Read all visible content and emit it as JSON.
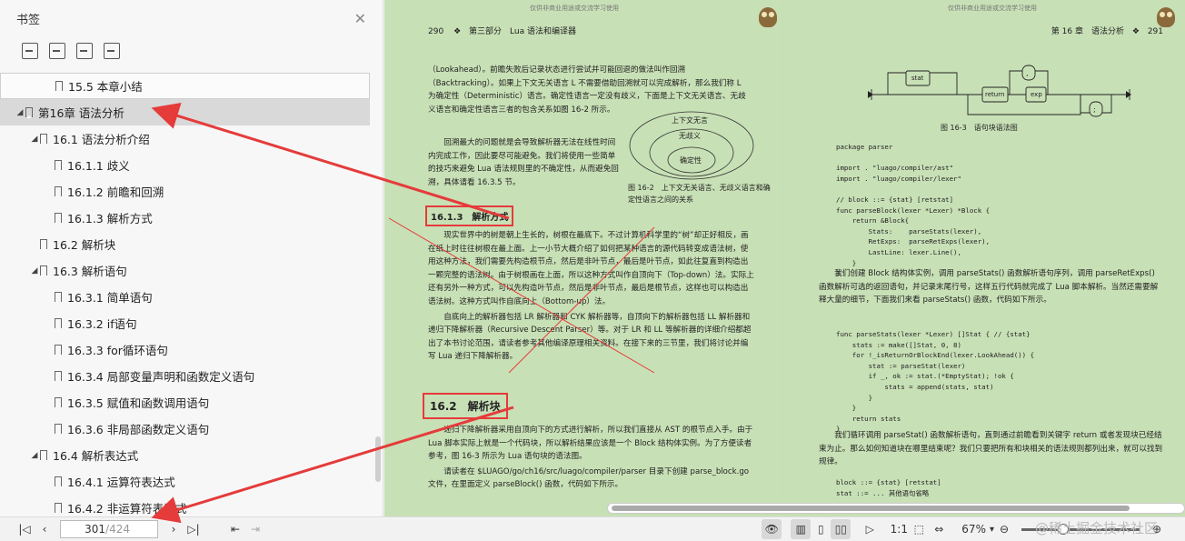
{
  "sidebar": {
    "title": "书签",
    "toc": [
      {
        "label": "15.5 本章小结",
        "level": 2,
        "caret": ""
      },
      {
        "label": "第16章 语法分析",
        "level": 0,
        "caret": "◢"
      },
      {
        "label": "16.1 语法分析介绍",
        "level": 1,
        "caret": "◢"
      },
      {
        "label": "16.1.1 歧义",
        "level": 2,
        "caret": ""
      },
      {
        "label": "16.1.2 前瞻和回溯",
        "level": 2,
        "caret": ""
      },
      {
        "label": "16.1.3 解析方式",
        "level": 2,
        "caret": ""
      },
      {
        "label": "16.2 解析块",
        "level": 1,
        "caret": ""
      },
      {
        "label": "16.3 解析语句",
        "level": 1,
        "caret": "◢"
      },
      {
        "label": "16.3.1 简单语句",
        "level": 2,
        "caret": ""
      },
      {
        "label": "16.3.2 if语句",
        "level": 2,
        "caret": ""
      },
      {
        "label": "16.3.3 for循环语句",
        "level": 2,
        "caret": ""
      },
      {
        "label": "16.3.4 局部变量声明和函数定义语句",
        "level": 2,
        "caret": ""
      },
      {
        "label": "16.3.5 赋值和函数调用语句",
        "level": 2,
        "caret": ""
      },
      {
        "label": "16.3.6 非局部函数定义语句",
        "level": 2,
        "caret": ""
      },
      {
        "label": "16.4 解析表达式",
        "level": 1,
        "caret": "◢"
      },
      {
        "label": "16.4.1 运算符表达式",
        "level": 2,
        "caret": ""
      },
      {
        "label": "16.4.2 非运算符表达式",
        "level": 2,
        "caret": ""
      }
    ]
  },
  "left_page": {
    "watermark": "仅供非商业用途或交流学习使用",
    "page_number": "290",
    "header": "第三部分　Lua 语法和编译器",
    "para1": "（Lookahead）。前瞻失败后记录状态进行尝试并可能回退的做法叫作回溯（Backtracking）。如果上下文无关语言 L 不需要借助回溯就可以完成解析，那么我们称 L 为确定性（Deterministic）语言。确定性语言一定没有歧义，下面是上下文无关语言、无歧义语言和确定性语言三者的包含关系如图 16-2 所示。",
    "para2": "回溯最大的问题就是会导致解析器无法在线性时间内完成工作，因此要尽可能避免。我们将使用一些简单的技巧来避免 Lua 语法规则里的不确定性，从而避免回溯，具体请看 16.3.5 节。",
    "fig_outer": "上下文无言",
    "fig_mid": "无歧义",
    "fig_inner": "确定性",
    "fig_caption": "图 16-2　上下文无关语言、无歧义语言和确定性语言之间的关系",
    "h3": "16.1.3　解析方式",
    "para3": "现实世界中的树是朝上生长的，树根在最底下。不过计算机科学里的“树”却正好相反，画在纸上时往往树根在最上面。上一小节大概介绍了如何把某种语言的源代码转变成语法树，使用这种方法，我们需要先构造根节点，然后是非叶节点，最后是叶节点，如此往复直到构造出一颗完整的语法树。由于树根画在上面，所以这种方式叫作自顶向下（Top-down）法。实际上还有另外一种方式，可以先构造叶节点，然后是非叶节点，最后是根节点，这样也可以构造出语法树。这种方式叫作自底向上（Bottom-up）法。",
    "para4": "自底向上的解析器包括 LR 解析器和 CYK 解析器等，自顶向下的解析器包括 LL 解析器和递归下降解析器（Recursive Descent Parser）等。对于 LR 和 LL 等解析器的详细介绍都超出了本书讨论范围，请读者参考其他编译原理相关资料。在接下来的三节里，我们将讨论并编写 Lua 递归下降解析器。",
    "h2": "16.2　解析块",
    "para5": "递归下降解析器采用自顶向下的方式进行解析，所以我们直接从 AST 的根节点入手。由于 Lua 脚本实际上就是一个代码块，所以解析结果应该是一个 Block 结构体实例。为了方便读者参考，图 16-3 所示为 Lua 语句块的语法图。",
    "para6": "请读者在 $LUAGO/go/ch16/src/luago/compiler/parser 目录下创建 parse_block.go 文件，在里面定义 parseBlock() 函数，代码如下所示。"
  },
  "right_page": {
    "watermark": "仅供非商业用途或交流学习使用",
    "page_number": "291",
    "header": "第 16 章　语法分析",
    "diagram_stat": "stat",
    "diagram_return": "return",
    "diagram_exp": "exp",
    "diagram_comma": ",",
    "diagram_semi": ";",
    "fig_caption": "图 16-3　语句块语法图",
    "code1": "package parser\n\nimport . \"luago/compiler/ast\"\nimport . \"luago/compiler/lexer\"\n\n// block ::= {stat} [retstat]\nfunc parseBlock(lexer *Lexer) *Block {\n    return &Block{\n        Stats:    parseStats(lexer),\n        RetExps:  parseRetExps(lexer),\n        LastLine: lexer.Line(),\n    }\n}",
    "para1": "我们创建 Block 结构体实例，调用 parseStats() 函数解析语句序列，调用 parseRetExps() 函数解析可选的返回语句，并记录末尾行号，这样五行代码就完成了 Lua 脚本解析。当然还需要解释大量的细节，下面我们来看 parseStats() 函数，代码如下所示。",
    "code2": "func parseStats(lexer *Lexer) []Stat { // {stat}\n    stats := make([]Stat, 0, 8)\n    for !_isReturnOrBlockEnd(lexer.LookAhead()) {\n        stat := parseStat(lexer)\n        if _, ok := stat.(*EmptyStat); !ok {\n            stats = append(stats, stat)\n        }\n    }\n    return stats\n}",
    "para2": "我们循环调用 parseStat() 函数解析语句，直到通过前瞻看到关键字 return 或者发现块已经结束为止。那么如何知道块在哪里结束呢？我们只要把所有和块相关的语法规则都列出来，就可以找到规律。",
    "code3": "block ::= {stat} [retstat]\nstat ::= ... 其他语句省略"
  },
  "toolbar": {
    "page_current": "301",
    "page_total": "/424",
    "zoom": "67%",
    "brand": "@稀土掘金技术社区"
  },
  "colors": {
    "page_bg": "#c8e0b6",
    "annotation": "#e53b3b",
    "active_toc": "#d9d9d9"
  }
}
